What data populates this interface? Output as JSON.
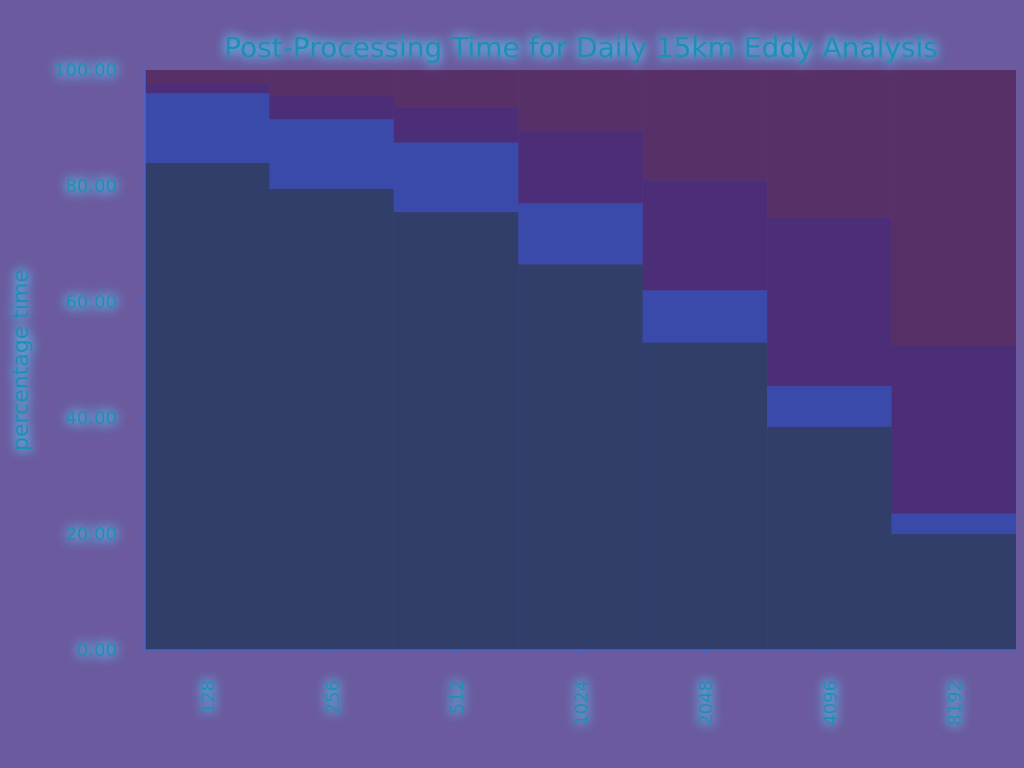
{
  "chart_data": {
    "type": "bar",
    "stacked": true,
    "title": "Post-Processing Time for Daily 15km Eddy Analysis",
    "xlabel": "",
    "ylabel": "percentage time",
    "ylim": [
      0,
      100
    ],
    "y_ticks": [
      "0.00",
      "20.00",
      "40.00",
      "60.00",
      "80.00",
      "100.00"
    ],
    "categories": [
      "128",
      "256",
      "512",
      "1024",
      "2048",
      "4096",
      "8192"
    ],
    "series": [
      {
        "values": [
          84,
          79.5,
          75.5,
          66.5,
          53,
          38.5,
          20
        ],
        "color": "#323e6a"
      },
      {
        "values": [
          12,
          12,
          12,
          10.5,
          9,
          7,
          3.5
        ],
        "color": "#3a4aaa"
      },
      {
        "values": [
          1.5,
          4,
          6,
          12.5,
          19,
          29,
          29
        ],
        "color": "#4c2e78"
      },
      {
        "values": [
          2.5,
          4.5,
          6.5,
          10.5,
          19,
          25.5,
          47.5
        ],
        "color": "#583068"
      }
    ],
    "grid": false,
    "legend": "none"
  },
  "colors": {
    "background": "#6b5a9e",
    "plot_background": "#5e5095",
    "text": "#1e8fb2",
    "glow": "#5fd0ff",
    "axis": "#4a63c8"
  }
}
